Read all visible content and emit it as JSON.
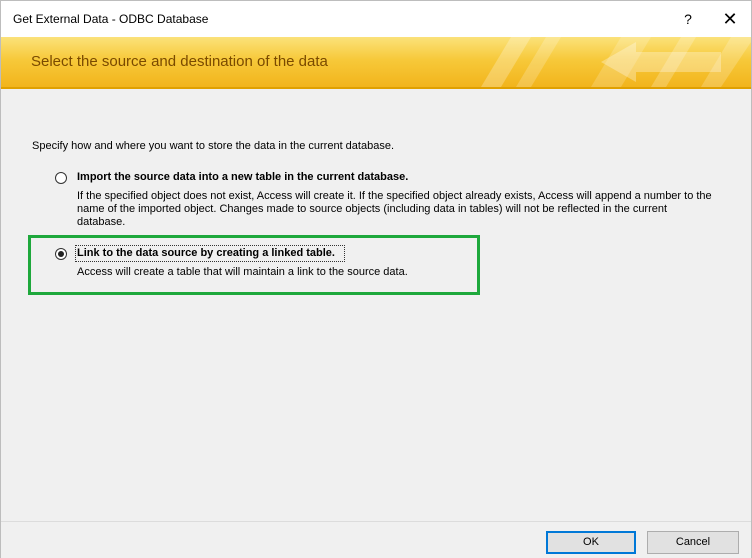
{
  "window": {
    "title": "Get External Data - ODBC Database",
    "help_label": "?",
    "close_label": "✕"
  },
  "banner": {
    "heading": "Select the source and destination of the data"
  },
  "main": {
    "instruction": "Specify how and where you want to store the data in the current database.",
    "options": [
      {
        "label": "Import the source data into a new table in the current database.",
        "description": "If the specified object does not exist, Access will create it. If the specified object already exists, Access will append a number to the name of the imported object. Changes made to source objects (including data in tables) will not be reflected in the current database.",
        "selected": false
      },
      {
        "label": "Link to the data source by creating a linked table.",
        "description": "Access will create a table that will maintain a link to the source data.",
        "selected": true
      }
    ]
  },
  "footer": {
    "ok_label": "OK",
    "cancel_label": "Cancel"
  },
  "colors": {
    "banner_gradient_top": "#fbe27a",
    "banner_gradient_bottom": "#f2b41c",
    "highlight_border": "#1ea83c",
    "default_button_border": "#0078d7"
  }
}
